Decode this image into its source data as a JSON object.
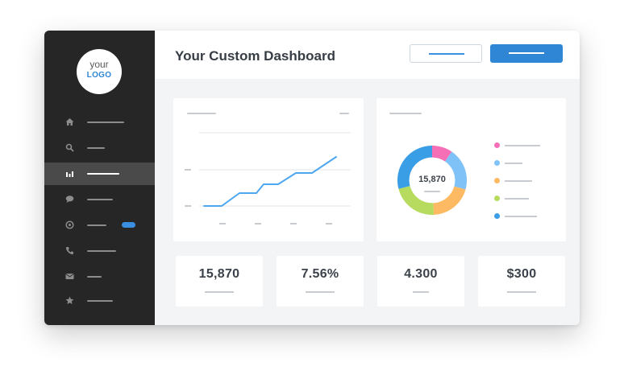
{
  "header": {
    "title": "Your Custom Dashboard"
  },
  "sidebar": {
    "logo": {
      "line1": "your",
      "line2": "LOGO"
    },
    "items": [
      {
        "icon": "home-icon"
      },
      {
        "icon": "search-icon"
      },
      {
        "icon": "bar-chart-icon",
        "active": true
      },
      {
        "icon": "chat-bubble-icon"
      },
      {
        "icon": "settings-icon",
        "badge": true
      },
      {
        "icon": "phone-icon"
      },
      {
        "icon": "mail-icon"
      },
      {
        "icon": "star-icon"
      }
    ]
  },
  "line_chart": {
    "line_color": "#4ea7ef"
  },
  "donut": {
    "center_value": "15,870",
    "segment_colors": [
      "#f56fb7",
      "#7fc2f8",
      "#fdba62",
      "#b7db5f",
      "#3a9ee6"
    ]
  },
  "stats": [
    {
      "value": "15,870"
    },
    {
      "value": "7.56%"
    },
    {
      "value": "4.300"
    },
    {
      "value": "$300"
    }
  ],
  "colors": {
    "accent": "#2f86d4",
    "sidebar": "#262626",
    "sidebar_active": "#4a4a4a",
    "background": "#f3f4f6"
  }
}
